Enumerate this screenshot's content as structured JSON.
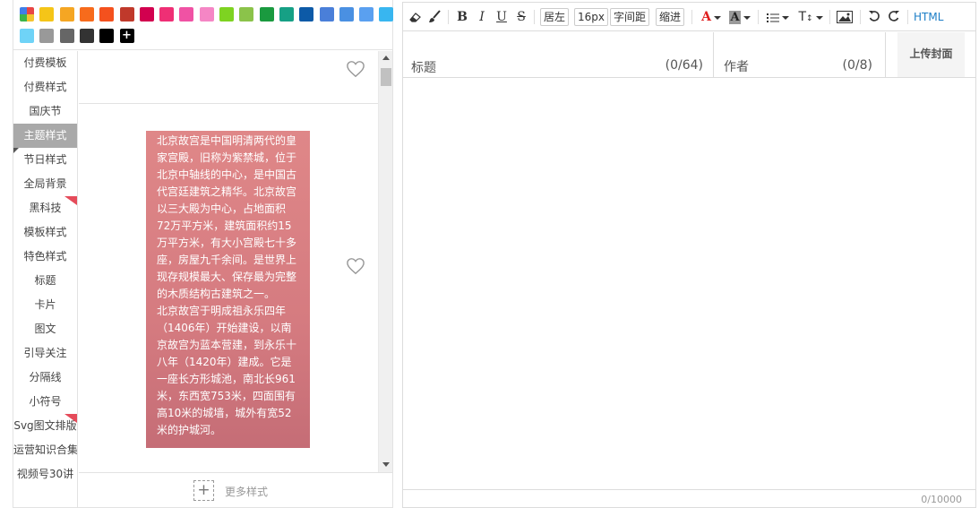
{
  "swatches": {
    "colors": [
      "#f5c518",
      "#f5a623",
      "#f76b1c",
      "#f4511e",
      "#c0392b",
      "#d2004f",
      "#ef2f75",
      "#f052a4",
      "#f586c5",
      "#7ed321",
      "#8bc34a",
      "#1a9a3f",
      "#16a085",
      "#0d5aa7",
      "#4a7fd9",
      "#4a90e2",
      "#5aa0f0",
      "#38b6f0",
      "#6fd3f7",
      "#999999",
      "#666666",
      "#333333",
      "#000000"
    ],
    "plus_label": "+"
  },
  "sidebar": {
    "items": [
      {
        "label": "付费模板",
        "flag": false
      },
      {
        "label": "付费样式",
        "flag": false
      },
      {
        "label": "国庆节",
        "flag": false
      },
      {
        "label": "主题样式",
        "flag": false
      },
      {
        "label": "节日样式",
        "flag": false
      },
      {
        "label": "全局背景",
        "flag": false
      },
      {
        "label": "黑科技",
        "flag": true
      },
      {
        "label": "模板样式",
        "flag": false
      },
      {
        "label": "特色样式",
        "flag": false
      },
      {
        "label": "标题",
        "flag": false
      },
      {
        "label": "卡片",
        "flag": false
      },
      {
        "label": "图文",
        "flag": false
      },
      {
        "label": "引导关注",
        "flag": false
      },
      {
        "label": "分隔线",
        "flag": false
      },
      {
        "label": "小符号",
        "flag": false
      },
      {
        "label": "Svg图文排版",
        "flag": true
      },
      {
        "label": "运营知识合集",
        "flag": false
      },
      {
        "label": "视频号30讲",
        "flag": false
      }
    ],
    "active_index": 3
  },
  "style_list": {
    "text_card": {
      "paragraph1": "北京故宫是中国明清两代的皇家宫殿，旧称为紫禁城，位于北京中轴线的中心，是中国古代宫廷建筑之精华。北京故宫以三大殿为中心，占地面积72万平方米，建筑面积约15万平方米，有大小宫殿七十多座，房屋九千余间。是世界上现存规模最大、保存最为完整的木质结构古建筑之一。",
      "paragraph2": "北京故宫于明成祖永乐四年（1406年）开始建设，以南京故宫为蓝本营建，到永乐十八年（1420年）建成。它是一座长方形城池，南北长961米，东西宽753米，四面围有高10米的城墙，城外有宽52米的护城河。"
    },
    "more_icon": "+",
    "more_label": "更多样式"
  },
  "toolbar": {
    "bold": "B",
    "italic": "I",
    "underline": "U",
    "strike": "S",
    "align_label": "居左",
    "font_size": "16px",
    "letter_spacing_label": "字间距",
    "indent_label": "缩进",
    "font_color_glyph": "A",
    "bg_color_glyph": "A",
    "line_height_glyph": "T",
    "html_label": "HTML",
    "font_color": "#e02020",
    "accent_color": "#1c7ec7"
  },
  "editor": {
    "title_placeholder": "标题",
    "title_counter": "(0/64)",
    "author_placeholder": "作者",
    "author_counter": "(0/8)",
    "upload_cover_label": "上传封面",
    "char_counter": "0/10000"
  }
}
